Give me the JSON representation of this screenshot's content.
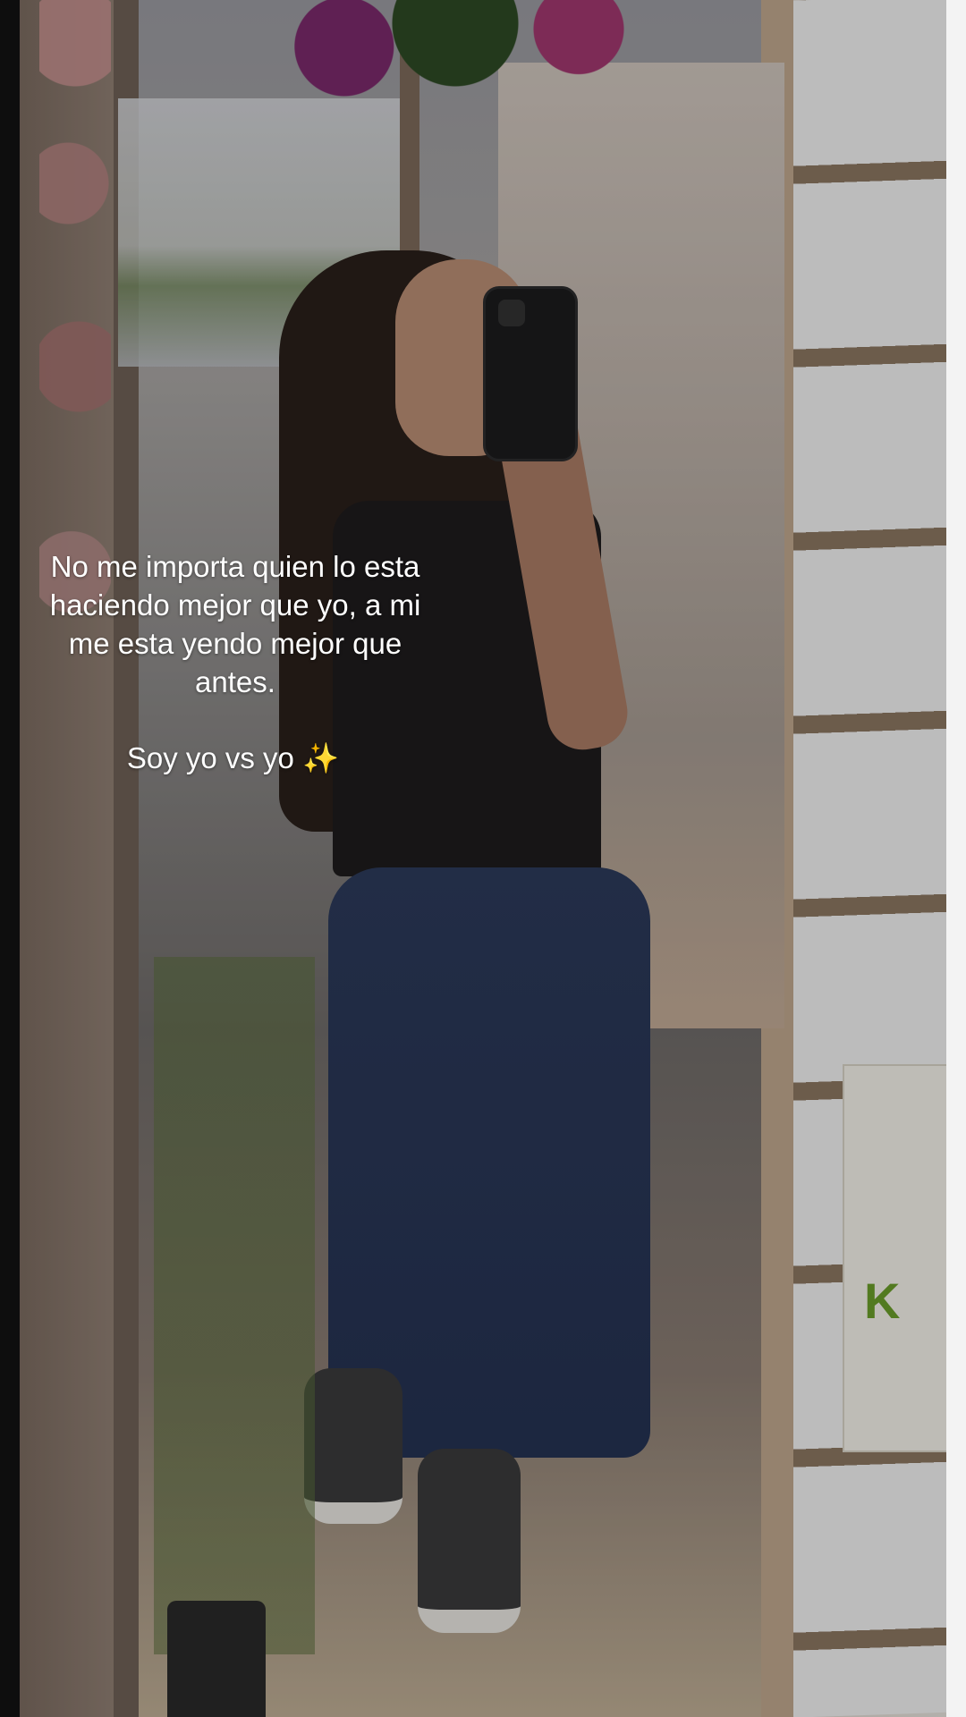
{
  "caption": {
    "line1": "No me importa quien lo esta",
    "line2": "haciendo mejor que yo, a mi",
    "line3": "me esta yendo mejor que",
    "line4": "antes.",
    "subline": "Soy yo vs yo",
    "sparkle": "✨"
  },
  "product_box": {
    "label": "K"
  },
  "colors": {
    "caption_text": "#ffffff",
    "sparkle": "#f4d35e",
    "jeans": "#2c3a5a",
    "top": "#1e1c1d"
  }
}
